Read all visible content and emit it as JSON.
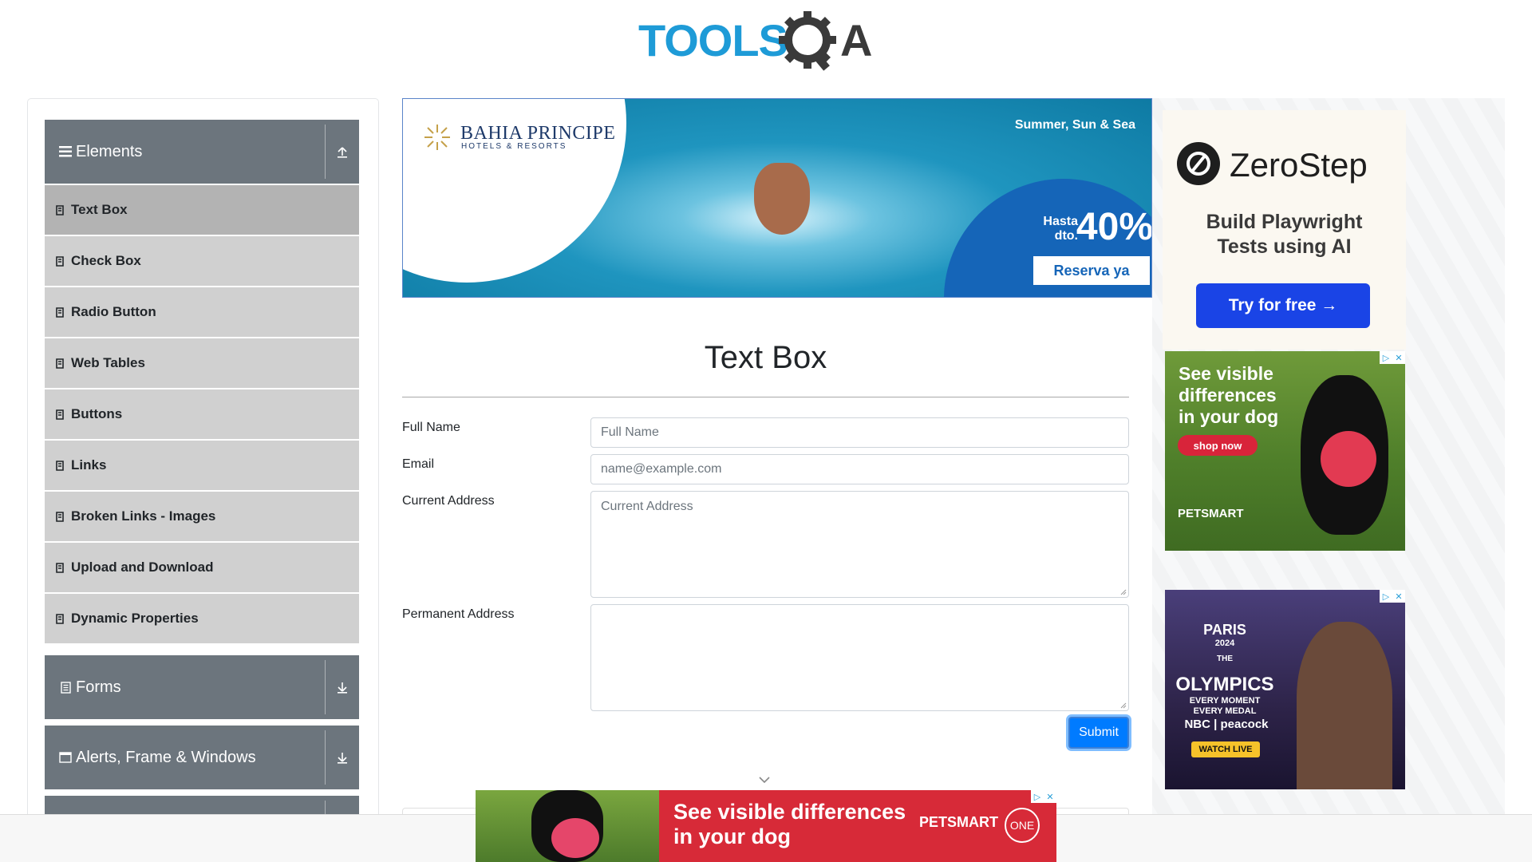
{
  "header": {
    "logo_text_left": "TOOLS",
    "logo_text_right": "A"
  },
  "sidebar": {
    "groups": [
      {
        "label": "Elements",
        "icon": "hamburger-icon",
        "toggle_icon": "collapse-up-icon",
        "items": [
          {
            "label": "Text Box",
            "active": true
          },
          {
            "label": "Check Box"
          },
          {
            "label": "Radio Button"
          },
          {
            "label": "Web Tables"
          },
          {
            "label": "Buttons"
          },
          {
            "label": "Links"
          },
          {
            "label": "Broken Links - Images"
          },
          {
            "label": "Upload and Download"
          },
          {
            "label": "Dynamic Properties"
          }
        ]
      },
      {
        "label": "Forms",
        "icon": "form-icon",
        "toggle_icon": "expand-down-icon"
      },
      {
        "label": "Alerts, Frame & Windows",
        "icon": "window-icon",
        "toggle_icon": "expand-down-icon"
      }
    ]
  },
  "banner_ad": {
    "brand": "BAHIA PRINCIPE",
    "brand_sub": "HOTELS & RESORTS",
    "tagline": "Summer, Sun & Sea",
    "hasta": "Hasta",
    "dto": "dto.",
    "discount": "40%",
    "cta": "Reserva ya"
  },
  "main": {
    "title": "Text Box",
    "fields": {
      "full_name": {
        "label": "Full Name",
        "placeholder": "Full Name",
        "value": ""
      },
      "email": {
        "label": "Email",
        "placeholder": "name@example.com",
        "value": ""
      },
      "current_address": {
        "label": "Current Address",
        "placeholder": "Current Address",
        "value": ""
      },
      "permanent_address": {
        "label": "Permanent Address",
        "placeholder": "",
        "value": ""
      }
    },
    "submit_label": "Submit"
  },
  "right_ads": {
    "zerostep": {
      "name": "ZeroStep",
      "headline_1": "Build Playwright",
      "headline_2": "Tests using AI",
      "cta": "Try for free →"
    },
    "petsmart": {
      "line1": "See visible",
      "line2": "differences",
      "line3": "in your dog",
      "cta": "shop now",
      "brand": "PETSMART"
    },
    "olympics": {
      "city": "PARIS",
      "year": "2024",
      "the": "THE",
      "title": "OLYMPICS",
      "sub1": "EVERY MOMENT",
      "sub2": "EVERY MEDAL",
      "network": "NBC | peacock",
      "cta": "WATCH LIVE"
    }
  },
  "bottom_ad": {
    "line1": "See visible differences",
    "line2": "in your dog",
    "brand": "PETSMART",
    "badge": "ONE"
  },
  "colors": {
    "sidebar_header": "#6c757d",
    "menu_item": "#d0d0d0",
    "menu_item_active": "#b3b3b3",
    "submit": "#007bff",
    "logo_blue": "#1e9bd7",
    "logo_dark": "#3a3a3a"
  }
}
